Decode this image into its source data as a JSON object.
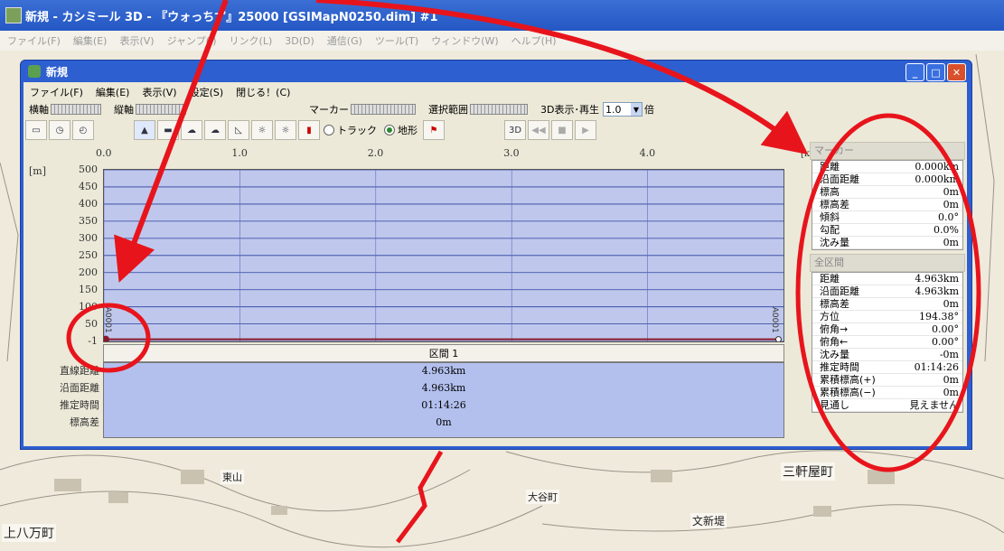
{
  "app": {
    "title": "新規 - カシミール 3D - 『ウォっちず』25000 [GSIMapN0250.dim] #1",
    "menu": [
      "ファイル(F)",
      "編集(E)",
      "表示(V)",
      "ジャンプ(J)",
      "リンク(L)",
      "3D(D)",
      "通信(G)",
      "ツール(T)",
      "ウィンドウ(W)",
      "ヘルプ(H)"
    ]
  },
  "map": {
    "labels": [
      "三軒屋町",
      "文新堤",
      "上八万町",
      "大谷町",
      "東山"
    ]
  },
  "window": {
    "title": "新規",
    "menu": [
      "ファイル(F)",
      "編集(E)",
      "表示(V)",
      "設定(S)",
      "閉じる！(C)"
    ],
    "toolbar1": {
      "yoko": "横軸",
      "tate": "縦軸",
      "marker": "マーカー",
      "range": "選択範囲",
      "play3d": "3D表示･再生",
      "speed": "1.0",
      "speed_unit": "倍"
    },
    "toolbar2": {
      "radio_track": "トラック",
      "radio_terrain": "地形"
    }
  },
  "chart_data": {
    "type": "line",
    "x_unit": "[km]",
    "y_unit": "[m]",
    "x_ticks": [
      "0.0",
      "1.0",
      "2.0",
      "3.0",
      "4.0"
    ],
    "y_ticks": [
      "500",
      "450",
      "400",
      "350",
      "300",
      "250",
      "200",
      "150",
      "100",
      "50",
      "-1"
    ],
    "xlim": [
      0,
      4.963
    ],
    "ylim": [
      -1,
      500
    ],
    "series": [
      {
        "x": [
          0,
          4.963
        ],
        "y": [
          0,
          0
        ],
        "color": "#8a1a2a"
      }
    ],
    "start_label": "A0001",
    "end_label": "A0001"
  },
  "section": {
    "label": "区間 1",
    "rows": [
      {
        "label": "直線距離",
        "value": "4.963km"
      },
      {
        "label": "沿面距離",
        "value": "4.963km"
      },
      {
        "label": "推定時間",
        "value": "01:14:26"
      },
      {
        "label": "標高差",
        "value": "0m"
      }
    ]
  },
  "panel": {
    "marker_head": "マーカー",
    "marker_rows": [
      {
        "k": "距離",
        "v": "0.000km"
      },
      {
        "k": "沿面距離",
        "v": "0.000km"
      },
      {
        "k": "標高",
        "v": "0m"
      },
      {
        "k": "標高差",
        "v": "0m"
      },
      {
        "k": "傾斜",
        "v": "0.0°"
      },
      {
        "k": "勾配",
        "v": "0.0%"
      },
      {
        "k": "沈み量",
        "v": "0m"
      }
    ],
    "all_head": "全区間",
    "all_rows": [
      {
        "k": "距離",
        "v": "4.963km"
      },
      {
        "k": "沿面距離",
        "v": "4.963km"
      },
      {
        "k": "標高差",
        "v": "0m"
      },
      {
        "k": "方位",
        "v": "194.38°"
      },
      {
        "k": "俯角→",
        "v": "0.00°"
      },
      {
        "k": "俯角←",
        "v": "0.00°"
      },
      {
        "k": "沈み量",
        "v": "-0m"
      },
      {
        "k": "推定時間",
        "v": "01:14:26"
      },
      {
        "k": "累積標高(+)",
        "v": "0m"
      },
      {
        "k": "累積標高(−)",
        "v": "0m"
      },
      {
        "k": "見通し",
        "v": "見えません"
      }
    ]
  },
  "colors": {
    "annotation": "#e8141c",
    "plot_bg": "#bfc8ec",
    "stats_bg": "#b3c0ee"
  }
}
